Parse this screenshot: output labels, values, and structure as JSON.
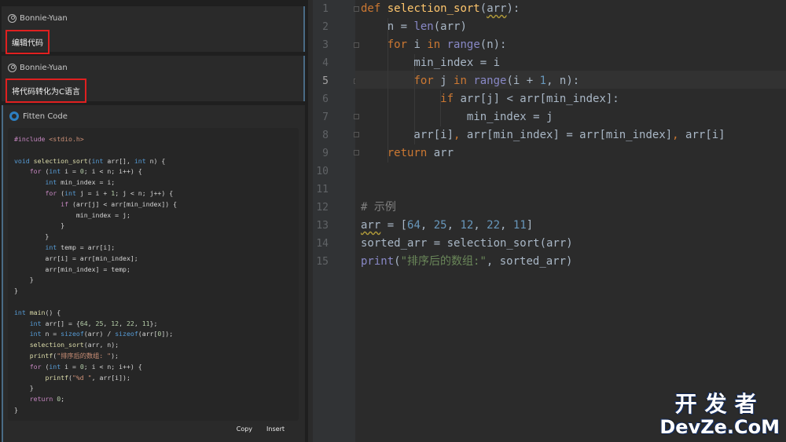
{
  "chat": {
    "messages": [
      {
        "author": "Bonnie-Yuan",
        "text": "编辑代码"
      },
      {
        "author": "Bonnie-Yuan",
        "text": "将代码转化为C语言"
      }
    ],
    "reply_author": "Fitten Code",
    "copy_label": "Copy",
    "insert_label": "Insert"
  },
  "editor": {
    "line_numbers": [
      "1",
      "2",
      "3",
      "4",
      "5",
      "6",
      "7",
      "8",
      "9",
      "10",
      "11",
      "12",
      "13",
      "14",
      "15"
    ],
    "active_line": 5
  },
  "watermark": {
    "cn": "开发者",
    "en": "DevZe.CoM"
  }
}
